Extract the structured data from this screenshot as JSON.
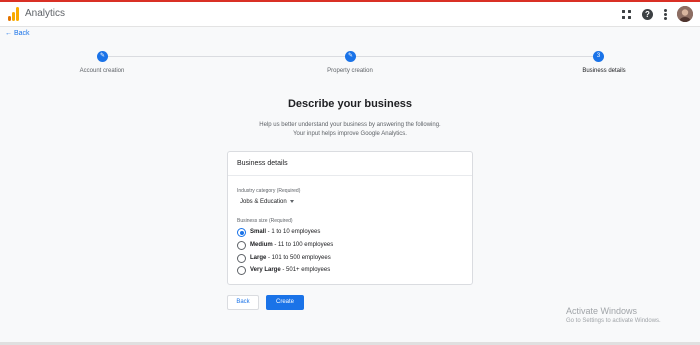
{
  "app": {
    "title": "Analytics"
  },
  "colors": {
    "accent": "#1a73e8",
    "logo_orange": "#f9ab00",
    "logo_dark": "#e37400"
  },
  "icons": [
    "analytics-logo-icon",
    "apps-grid-icon",
    "help-icon",
    "more-vert-icon",
    "avatar",
    "arrow-back-icon",
    "edit-pencil-icon"
  ],
  "nav": {
    "back_label": "Back",
    "back_arrow": "←"
  },
  "stepper": {
    "steps": [
      {
        "label": "Account creation",
        "marker": "✎",
        "state": "completed"
      },
      {
        "label": "Property creation",
        "marker": "✎",
        "state": "completed"
      },
      {
        "label": "Business details",
        "marker": "3",
        "state": "current"
      }
    ]
  },
  "page": {
    "heading": "Describe your business",
    "subtitle_line1": "Help us better understand your business by answering the following.",
    "subtitle_line2": "Your input helps improve Google Analytics."
  },
  "card": {
    "title": "Business details",
    "industry_label": "Industry category (Required)",
    "industry_value": "Jobs & Education",
    "size_label": "Business size (Required)",
    "size_options": [
      {
        "bold": "Small",
        "rest": " - 1 to 10 employees",
        "checked": true
      },
      {
        "bold": "Medium",
        "rest": " - 11 to 100 employees",
        "checked": false
      },
      {
        "bold": "Large",
        "rest": " - 101 to 500 employees",
        "checked": false
      },
      {
        "bold": "Very Large",
        "rest": " - 501+ employees",
        "checked": false
      }
    ]
  },
  "actions": {
    "back": "Back",
    "create": "Create"
  },
  "watermark": {
    "title": "Activate Windows",
    "subtitle": "Go to Settings to activate Windows."
  }
}
